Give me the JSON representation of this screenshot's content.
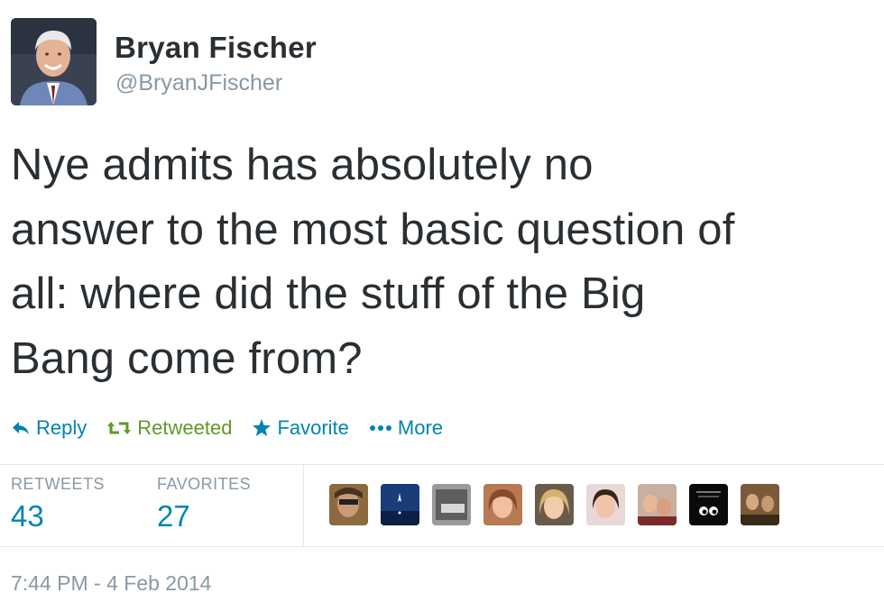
{
  "author": {
    "name": "Bryan Fischer",
    "handle": "@BryanJFischer"
  },
  "tweet": {
    "text_lines": [
      "Nye admits has absolutely no",
      "answer to the most basic question of",
      "all: where did the stuff of the Big",
      "Bang come from?"
    ]
  },
  "actions": {
    "reply_label": "Reply",
    "retweet_label": "Retweeted",
    "favorite_label": "Favorite",
    "more_label": "More"
  },
  "stats": {
    "retweets_label": "RETWEETS",
    "retweets_count": "43",
    "favorites_label": "FAVORITES",
    "favorites_count": "27"
  },
  "favoriters": [
    "user-avatar-1",
    "user-avatar-2",
    "user-avatar-3",
    "user-avatar-4",
    "user-avatar-5",
    "user-avatar-6",
    "user-avatar-7",
    "user-avatar-8",
    "user-avatar-9"
  ],
  "timestamp": "7:44 PM - 4 Feb 2014",
  "colors": {
    "link": "#0084b4",
    "retweeted": "#609928",
    "muted": "#8899a6",
    "text": "#292f33"
  }
}
